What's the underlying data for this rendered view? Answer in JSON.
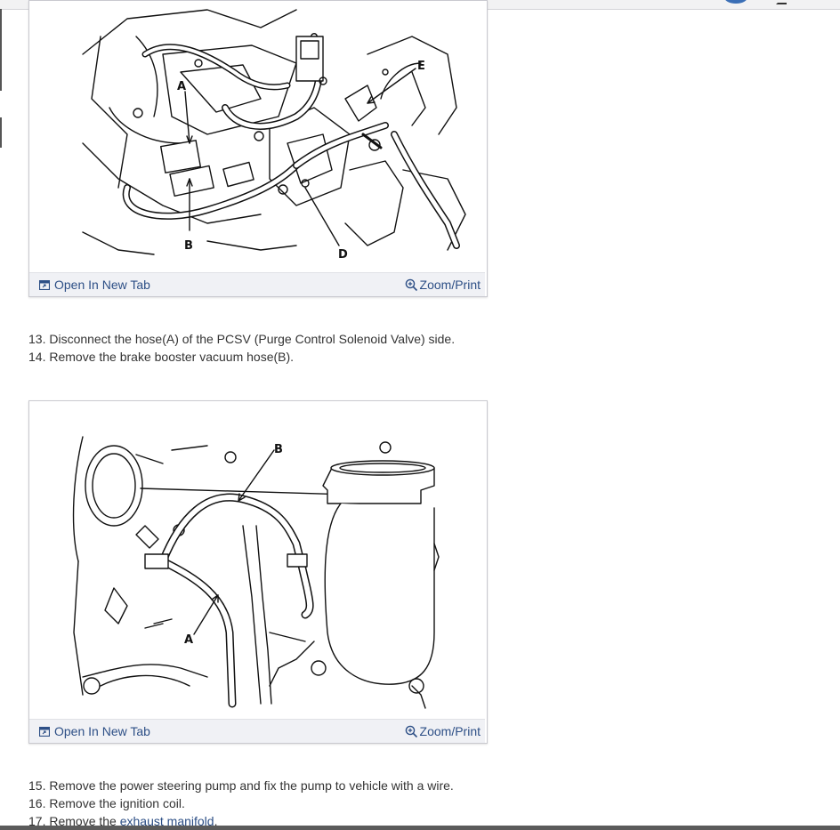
{
  "figures": [
    {
      "callouts": [
        "A",
        "B",
        "D",
        "E"
      ],
      "open_tab_label": "Open In New Tab",
      "zoom_label": "Zoom/Print"
    },
    {
      "callouts": [
        "A",
        "B"
      ],
      "open_tab_label": "Open In New Tab",
      "zoom_label": "Zoom/Print"
    }
  ],
  "steps_group_1": [
    "13. Disconnect the hose(A) of the PCSV (Purge Control Solenoid Valve) side.",
    "14. Remove the brake booster vacuum hose(B)."
  ],
  "steps_group_2": [
    "15. Remove the power steering pump and fix the pump to vehicle with a wire.",
    "16. Remove the ignition coil."
  ],
  "step_17": {
    "prefix": "17. Remove the ",
    "link_text": "exhaust manifold",
    "suffix": "."
  },
  "icons": {
    "open_tab": "open-in-new-tab-icon",
    "zoom": "magnifier-plus-icon"
  },
  "colors": {
    "link": "#2d4f86",
    "text": "#333333",
    "caption_bar": "#f0f1f5"
  }
}
